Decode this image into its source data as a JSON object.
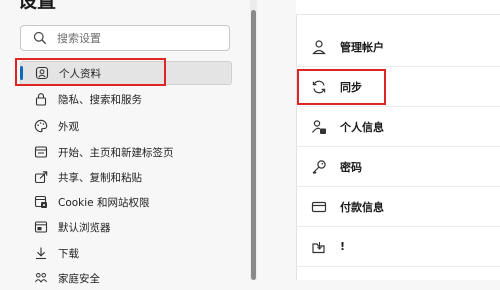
{
  "settings_title": "设置",
  "search": {
    "placeholder": "搜索设置"
  },
  "sidebar": {
    "items": [
      {
        "label": "个人资料",
        "icon": "profile-icon"
      },
      {
        "label": "隐私、搜索和服务",
        "icon": "lock-icon"
      },
      {
        "label": "外观",
        "icon": "appearance-icon"
      },
      {
        "label": "开始、主页和新建标签页",
        "icon": "home-tab-icon"
      },
      {
        "label": "共享、复制和粘贴",
        "icon": "share-icon"
      },
      {
        "label": "Cookie 和网站权限",
        "icon": "site-permissions-icon"
      },
      {
        "label": "默认浏览器",
        "icon": "default-browser-icon"
      },
      {
        "label": "下载",
        "icon": "download-icon"
      },
      {
        "label": "家庭安全",
        "icon": "family-icon"
      }
    ]
  },
  "profile_panel": {
    "rows": [
      {
        "label": "管理帐户",
        "icon": "person-icon"
      },
      {
        "label": "同步",
        "icon": "sync-icon"
      },
      {
        "label": "个人信息",
        "icon": "personal-info-icon"
      },
      {
        "label": "密码",
        "icon": "key-icon"
      },
      {
        "label": "付款信息",
        "icon": "card-icon"
      },
      {
        "label": "!",
        "icon": "import-icon"
      }
    ]
  },
  "colors": {
    "accent": "#0f6cbd",
    "highlight": "#e02424"
  }
}
